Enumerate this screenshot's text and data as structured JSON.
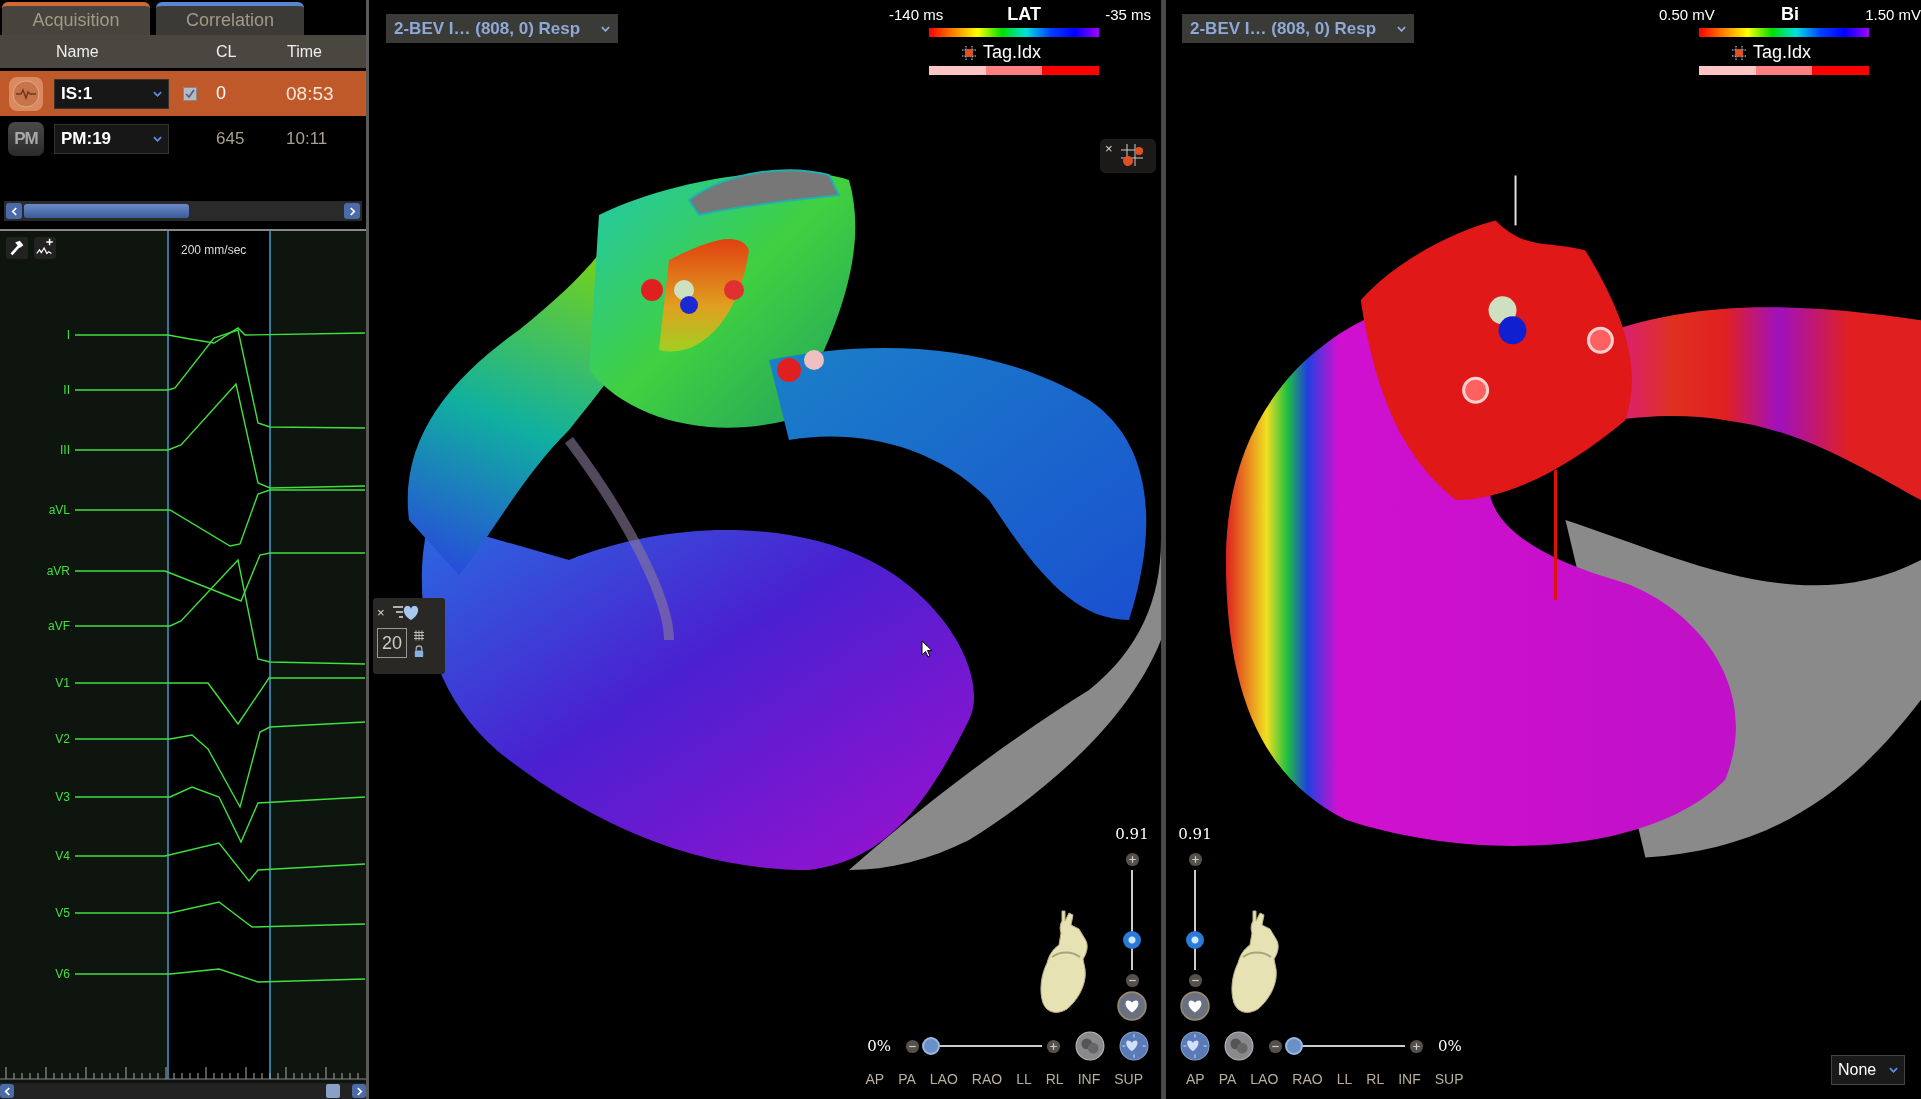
{
  "tabs": [
    {
      "label": "Acquisition",
      "selected": true
    },
    {
      "label": "Correlation",
      "selected": false
    }
  ],
  "table": {
    "columns": [
      "Name",
      "CL",
      "Time"
    ],
    "rows": [
      {
        "kind": "signal",
        "name": "IS:1",
        "checked": true,
        "cl": "0",
        "time": "08:53",
        "selected": true
      },
      {
        "kind": "pacing",
        "badge": "PM",
        "name": "PM:19",
        "checked": false,
        "cl": "645",
        "time": "10:11",
        "selected": false
      }
    ]
  },
  "ecg": {
    "speed": "200 mm/sec",
    "leads": [
      "I",
      "II",
      "III",
      "aVL",
      "aVR",
      "aVF",
      "V1",
      "V2",
      "V3",
      "V4",
      "V5",
      "V6"
    ]
  },
  "maps": [
    {
      "selector": "2-BEV I… (808, 0) Resp",
      "legend": {
        "min": "-140 ms",
        "title": "LAT",
        "max": "-35 ms",
        "tag_label": "Tag.Idx"
      },
      "tag_panel": {
        "close": "×"
      },
      "toolbox": {
        "close": "×",
        "count": "20"
      },
      "opacity": {
        "value": "0.91",
        "level": 0.3
      },
      "blend": {
        "value": "0%",
        "level": 0
      },
      "views": [
        "AP",
        "PA",
        "LAO",
        "RAO",
        "LL",
        "RL",
        "INF",
        "SUP"
      ]
    },
    {
      "selector": "2-BEV I… (808, 0) Resp",
      "legend": {
        "min": "0.50 mV",
        "title": "Bi",
        "max": "1.50 mV",
        "tag_label": "Tag.Idx"
      },
      "opacity": {
        "value": "0.91",
        "level": 0.3
      },
      "blend": {
        "value": "0%",
        "level": 0
      },
      "views": [
        "AP",
        "PA",
        "LAO",
        "RAO",
        "LL",
        "RL",
        "INF",
        "SUP"
      ],
      "filter": "None"
    }
  ]
}
